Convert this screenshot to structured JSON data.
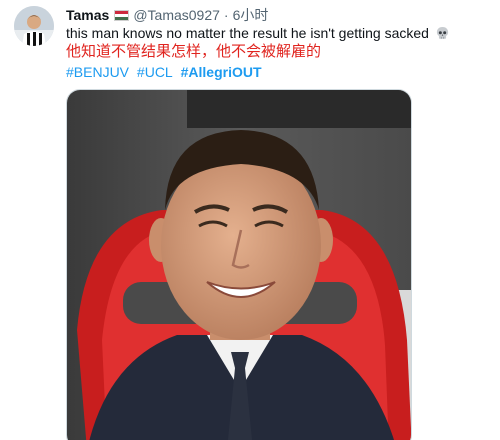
{
  "tweet": {
    "author_name": "Tamas",
    "flag": "hungary-flag-icon",
    "handle": "@Tamas0927",
    "separator": "·",
    "time": "6小时",
    "text": "this man knows no matter the result he isn't getting sacked",
    "emoji": "skull-icon",
    "translation": "他知道不管结果怎样，他不会被解雇的",
    "hashtags": [
      "#BENJUV",
      "#UCL",
      "#AllegriOUT"
    ]
  },
  "colors": {
    "text": "#0f1419",
    "muted": "#536471",
    "link": "#1d9bf0",
    "translation": "#e0241f"
  }
}
